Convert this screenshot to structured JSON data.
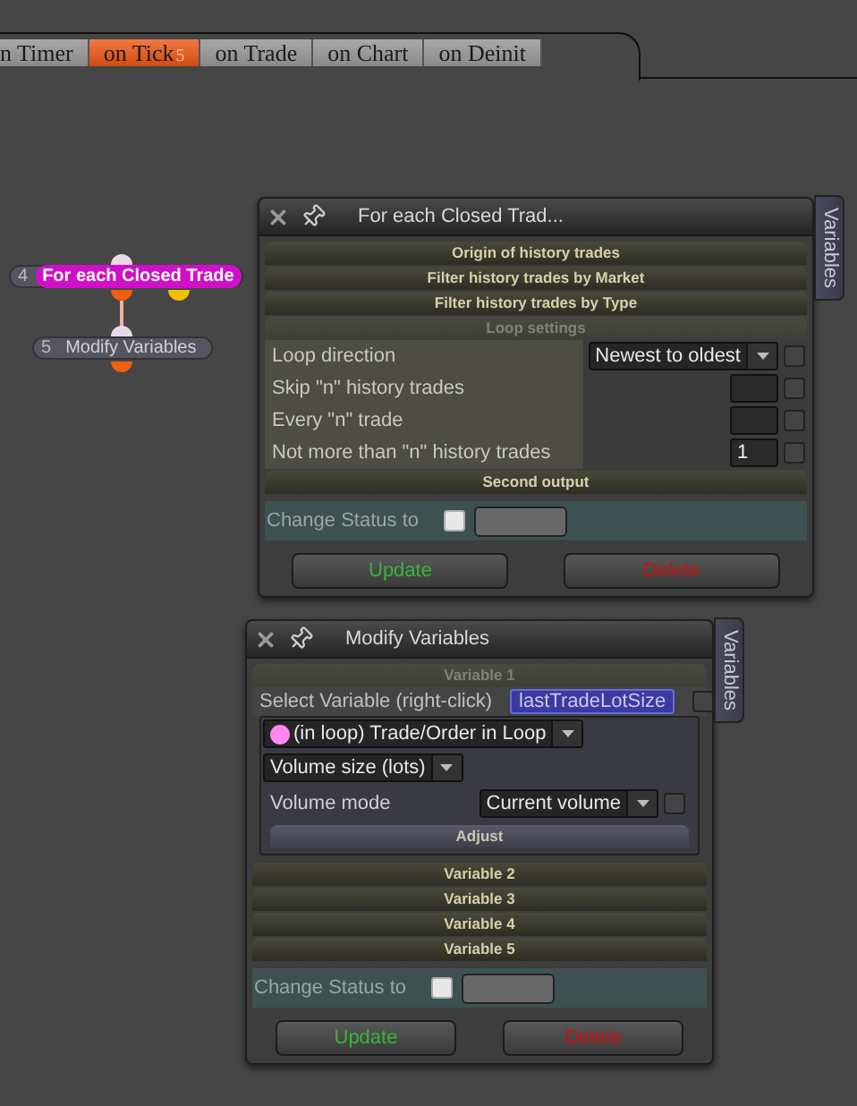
{
  "tabs": [
    {
      "label": "n Timer",
      "selected": false
    },
    {
      "label": "on Tick",
      "badge": "5",
      "selected": true
    },
    {
      "label": "on Trade",
      "selected": false
    },
    {
      "label": "on Chart",
      "selected": false
    },
    {
      "label": "on Deinit",
      "selected": false
    }
  ],
  "nodes": [
    {
      "number": "4",
      "label": "For each Closed Trade",
      "selected": true
    },
    {
      "number": "5",
      "label": "Modify Variables",
      "selected": false
    }
  ],
  "windows": [
    {
      "title": "For each Closed Trad...",
      "side_tab": "Variables",
      "sections": [
        {
          "label": "Origin of history trades",
          "expanded": false
        },
        {
          "label": "Filter history trades by Market",
          "expanded": false
        },
        {
          "label": "Filter history trades by Type",
          "expanded": false
        },
        {
          "label": "Loop settings",
          "expanded": true,
          "fields": [
            {
              "kind": "dropdown",
              "label": "Loop direction",
              "value": "Newest to oldest",
              "checked": false
            },
            {
              "kind": "number",
              "label": "Skip \"n\" history trades",
              "checked": false
            },
            {
              "kind": "number",
              "label": "Every \"n\" trade",
              "checked": false
            },
            {
              "kind": "number",
              "label": "Not more than \"n\" history trades",
              "value": "1",
              "checked": false
            }
          ]
        },
        {
          "label": "Second output",
          "expanded": false
        }
      ],
      "status": {
        "label": "Change Status to",
        "checked": false
      },
      "buttons": [
        {
          "label": "Update",
          "kind": "update"
        },
        {
          "label": "Delete",
          "kind": "delete"
        }
      ]
    },
    {
      "title": "Modify Variables",
      "side_tab": "Variables",
      "sections": [
        {
          "label": "Variable 1",
          "expanded": true,
          "variable": {
            "label": "Select Variable (right-click)",
            "name": "lastTradeLotSize",
            "checked": false,
            "source": "(in loop) Trade/Order in Loop",
            "color": "#ff88f0",
            "property": "Volume size (lots)",
            "mode": {
              "label": "Volume mode",
              "value": "Current volume",
              "checked": false
            },
            "subsection": "Adjust"
          }
        },
        {
          "label": "Variable 2",
          "expanded": false
        },
        {
          "label": "Variable 3",
          "expanded": false
        },
        {
          "label": "Variable 4",
          "expanded": false
        },
        {
          "label": "Variable 5",
          "expanded": false
        }
      ],
      "status": {
        "label": "Change Status to",
        "checked": false
      },
      "buttons": [
        {
          "label": "Update",
          "kind": "update"
        },
        {
          "label": "Delete",
          "kind": "delete"
        }
      ]
    }
  ]
}
